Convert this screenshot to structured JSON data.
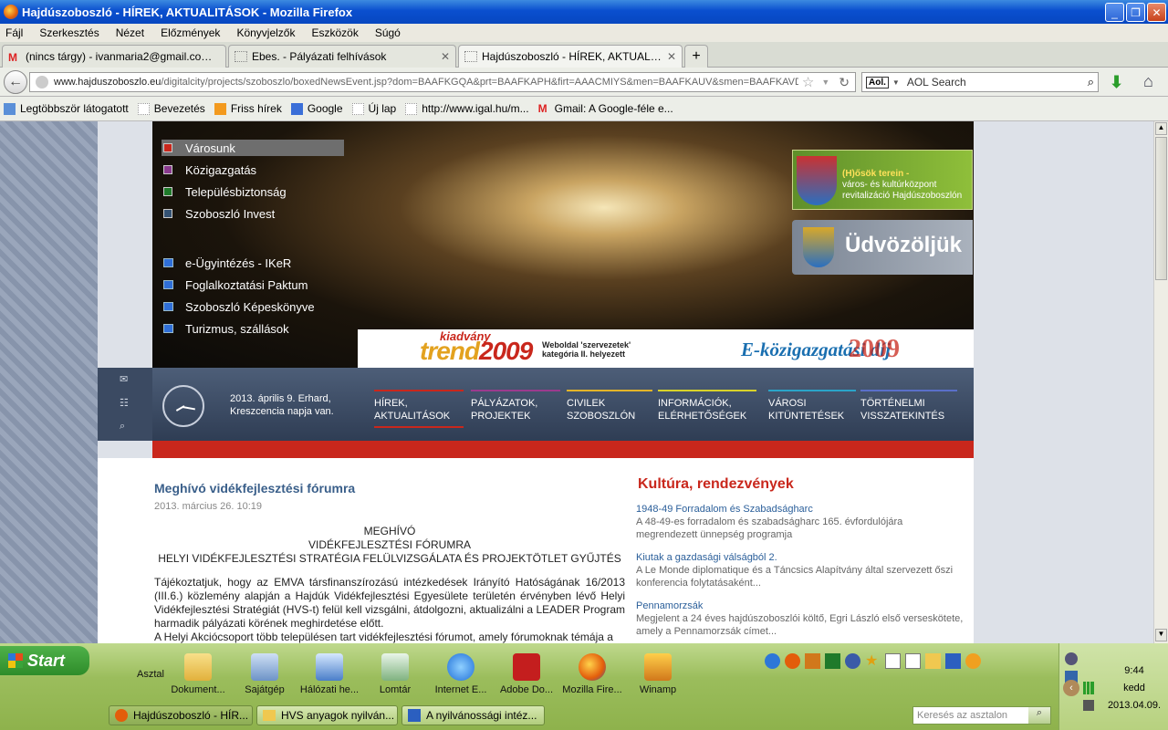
{
  "window": {
    "title": "Hajdúszoboszló - HÍREK, AKTUALITÁSOK - Mozilla Firefox"
  },
  "menu": [
    "Fájl",
    "Szerkesztés",
    "Nézet",
    "Előzmények",
    "Könyvjelzők",
    "Eszközök",
    "Súgó"
  ],
  "tabs": [
    {
      "label": "(nincs tárgy) - ivanmaria2@gmail.com - G..."
    },
    {
      "label": "Ebes. - Pályázati felhívások"
    },
    {
      "label": "Hajdúszoboszló - HÍREK, AKTUALITÁSOK"
    }
  ],
  "url": {
    "host": "www.hajduszoboszlo.eu",
    "path": "/digitalcity/projects/szoboszlo/boxedNewsEvent.jsp?dom=BAAFKGQA&prt=BAAFKAPH&firt=AAACMIYS&men=BAAFKAUV&smen=BAAFKAVD&fm"
  },
  "search": {
    "placeholder": "AOL Search"
  },
  "bookmarks": [
    "Legtöbbször látogatott",
    "Bevezetés",
    "Friss hírek",
    "Google",
    "Új lap",
    "http://www.igal.hu/m...",
    "Gmail: A Google-féle e..."
  ],
  "site": {
    "menu1": [
      "Városunk",
      "Közigazgatás",
      "Településbiztonság",
      "Szoboszló Invest"
    ],
    "menu2": [
      "e-Ügyintézés - IKeR",
      "Foglalkoztatási Paktum",
      "Szoboszló Képeskönyve",
      "Turizmus, szállások"
    ],
    "banner1": {
      "line1": "(H)ősök terein -",
      "line2": "város- és kultúrközpont",
      "line3": "revitalizáció Hajdúszoboszlón"
    },
    "banner2": "Üdvözöljük",
    "trend": {
      "kiadvany": "kiadvány",
      "trend": "trend",
      "year": "2009",
      "sub1": "Weboldal 'szervezetek'",
      "sub2": "kategória II. helyezett",
      "ekoz": "E-közigazgatási díj",
      "year2": "2009"
    },
    "nameday": {
      "line1": "2013. április 9. Erhard,",
      "line2": "Kreszcencia napja van."
    },
    "nav": [
      {
        "l1": "HÍREK,",
        "l2": "AKTUALITÁSOK",
        "color": "#c9271c"
      },
      {
        "l1": "PÁLYÁZATOK,",
        "l2": "PROJEKTEK",
        "color": "#9b3a8e"
      },
      {
        "l1": "CIVILEK",
        "l2": "SZOBOSZLÓN",
        "color": "#e3b429"
      },
      {
        "l1": "INFORMÁCIÓK,",
        "l2": "ELÉRHETŐSÉGEK",
        "color": "#d8d22a"
      },
      {
        "l1": "VÁROSI",
        "l2": "KITÜNTETÉSEK",
        "color": "#2aa4c9"
      },
      {
        "l1": "TÖRTÉNELMI",
        "l2": "VISSZATEKINTÉS",
        "color": "#5a6fc9"
      }
    ],
    "article": {
      "title": "Meghívó vidékfejlesztési fórumra",
      "date": "2013. március 26. 10:19",
      "h1": "MEGHÍVÓ",
      "h2": "VIDÉKFEJLESZTÉSI FÓRUMRA",
      "h3": "HELYI VIDÉKFEJLESZTÉSI STRATÉGIA FELÜLVIZSGÁLATA ÉS PROJEKTÖTLET GYŰJTÉS",
      "p1": "Tájékoztatjuk, hogy az EMVA társfinanszírozású intézkedések Irányító Hatóságának 16/2013 (III.6.) közlemény alapján a Hajdúk Vidékfejlesztési Egyesülete területén érvényben lévő Helyi Vidékfejlesztési Stratégiát (HVS-t) felül kell vizsgálni, átdolgozni, aktualizálni a LEADER Program harmadik pályázati körének meghirdetése előtt.",
      "p2": "A Helyi Akciócsoport több településen tart vidékfejlesztési fórumot, amely fórumoknak témája a"
    },
    "side": {
      "title": "Kultúra, rendezvények",
      "items": [
        {
          "t": "1948-49 Forradalom és Szabadságharc",
          "d": "A 48-49-es forradalom és szabadságharc 165. évfordulójára megrendezett ünnepség programja"
        },
        {
          "t": "Kiutak a gazdasági válságból 2.",
          "d": "A Le Monde diplomatique és a Táncsics Alapítvány által szervezett őszi konferencia folytatásaként..."
        },
        {
          "t": "Pennamorzsák",
          "d": "Megjelent a 24 éves hajdúszoboszlói költő, Egri László első verseskötete, amely a Pennamorzsák címet..."
        }
      ]
    }
  },
  "taskbar": {
    "start": "Start",
    "desktop_label": "Asztal",
    "icons": [
      "Dokument...",
      "Sajátgép",
      "Hálózati he...",
      "Lomtár",
      "Internet E...",
      "Adobe Do...",
      "Mozilla Fire...",
      "Winamp"
    ],
    "tasks": [
      "Hajdúszoboszló - HÍR...",
      "HVS anyagok nyilván...",
      "A nyilvánossági intéz..."
    ],
    "search_placeholder": "Keresés az asztalon",
    "clock": "9:44",
    "day": "kedd",
    "date": "2013.04.09."
  }
}
